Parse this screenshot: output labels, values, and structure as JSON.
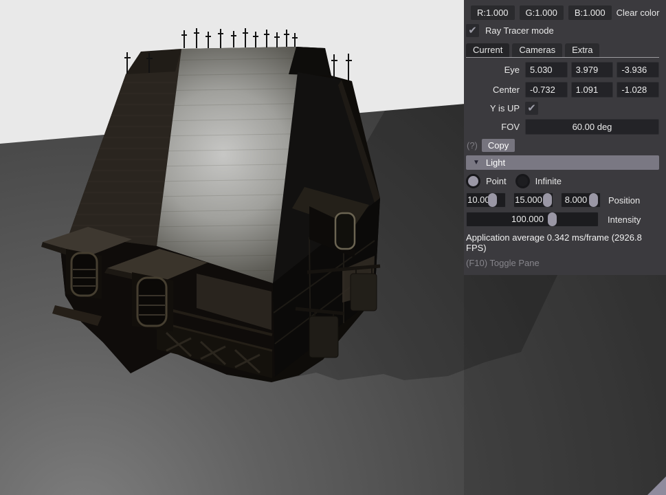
{
  "scene": {
    "description": "dark medieval timber-framed house 3D render",
    "sky_color": "#e9e9e9",
    "ground_dark": "#363636",
    "ground_light": "#7e7e7e",
    "shadow_color": "rgba(0,0,0,0.22)",
    "roof_dark": "#2a251f",
    "roof_highlight": "#c7c7c5",
    "wall_color": "#0e0c09"
  },
  "panel": {
    "color_row": {
      "swatch_color": "#ffffff",
      "r": "R:1.000",
      "g": "G:1.000",
      "b": "B:1.000",
      "clear": "Clear color"
    },
    "ray_tracer": {
      "label": "Ray Tracer mode",
      "check_glyph": "✔"
    },
    "tabs": [
      {
        "label": "Current"
      },
      {
        "label": "Cameras"
      },
      {
        "label": "Extra"
      }
    ],
    "camera": {
      "eye": {
        "label": "Eye",
        "x": "5.030",
        "y": "3.979",
        "z": "-3.936"
      },
      "center": {
        "label": "Center",
        "x": "-0.732",
        "y": "1.091",
        "z": "-1.028"
      },
      "y_up": {
        "label": "Y is UP",
        "check_glyph": "✔"
      },
      "fov": {
        "label": "FOV",
        "value": "60.00 deg"
      },
      "help": "(?)",
      "copy": "Copy"
    },
    "light": {
      "collapse_glyph": "▼",
      "title": "Light",
      "point_label": "Point",
      "infinite_label": "Infinite",
      "position": {
        "label": "Position",
        "values": [
          "10.000",
          "15.000",
          "8.000"
        ],
        "pill_styles": [
          "left:56%",
          "left:75%",
          "left:72%"
        ]
      },
      "intensity": {
        "label": "Intensity",
        "value": "100.000",
        "pill_style": "left:62%"
      }
    },
    "stats": "Application average 0.342 ms/frame (2926.8 FPS)",
    "toggle_hint": "(F10) Toggle Pane"
  }
}
